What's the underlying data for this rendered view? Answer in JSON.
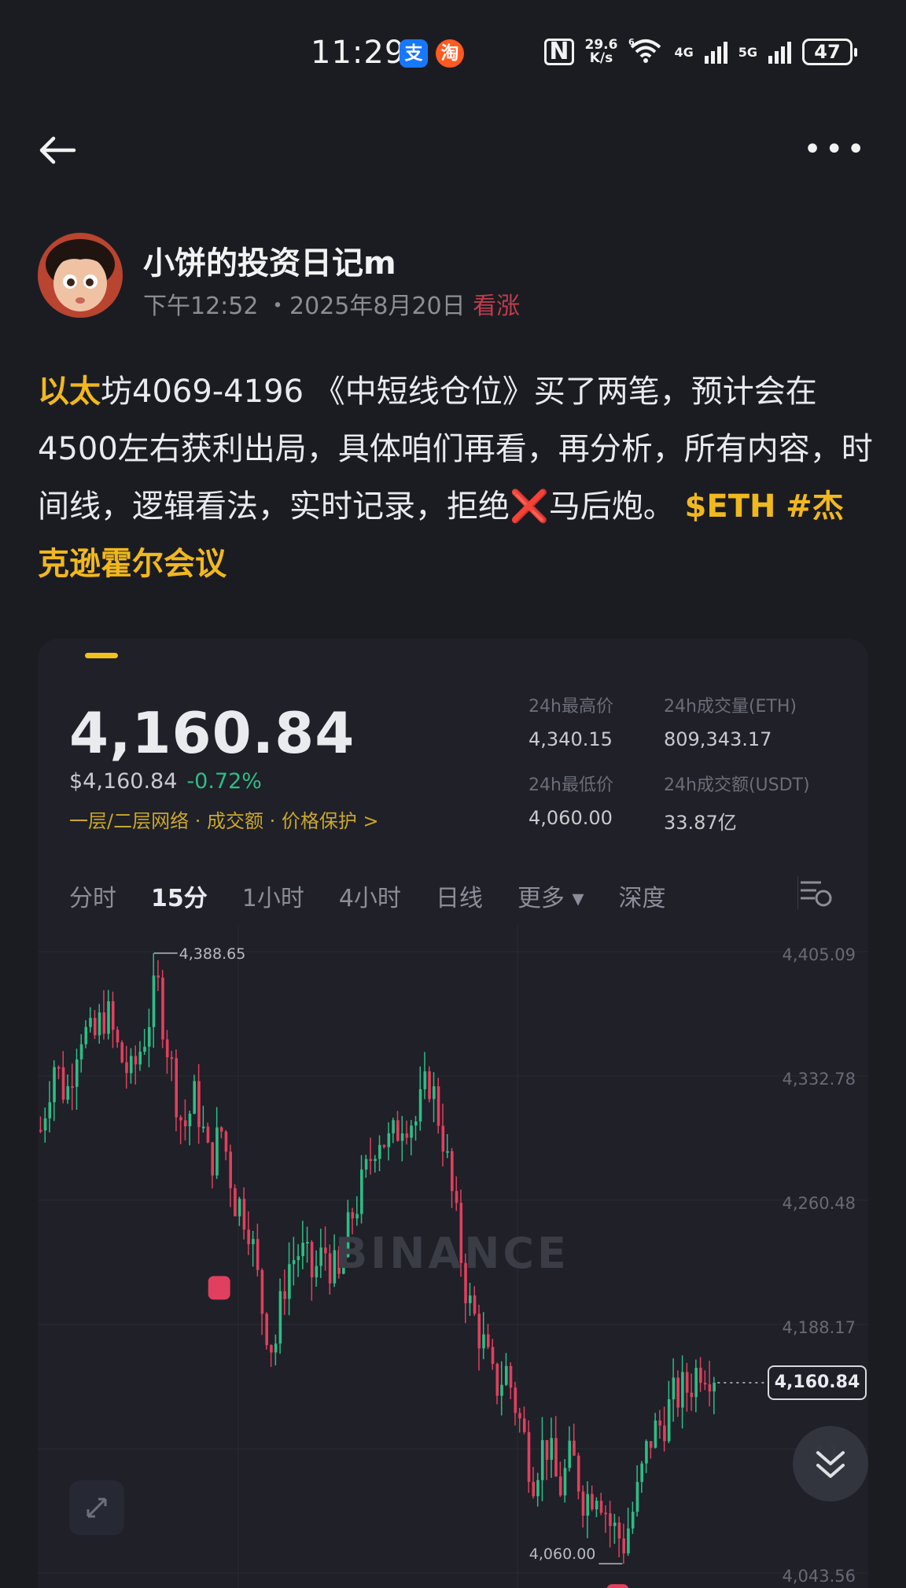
{
  "status_bar": {
    "time": "11:29",
    "app_icons": [
      "支",
      "淘"
    ],
    "net_speed_value": "29.6",
    "net_speed_unit": "K/s",
    "wifi_label": "6",
    "sig1_label": "4G",
    "sig2_label": "5G",
    "battery": "47"
  },
  "author": {
    "name": "小饼的投资日记m",
    "time": "下午12:52",
    "date": "・2025年8月20日",
    "sentiment": "看涨"
  },
  "post": {
    "lead_highlight": "以太",
    "text_part1": "坊4069-4196 《中短线仓位》买了两笔，预计会在4500左右获利出局，具体咱们再看，再分析，所有内容，时间线，逻辑看法，实时记录，拒绝",
    "cross_emoji": "❌",
    "text_part2": "马后炮。",
    "tag_symbol": "$ETH",
    "tag_topic": "#杰克逊霍尔会议"
  },
  "market": {
    "price": "4,160.84",
    "price_usd": "$4,160.84",
    "change": "-0.72%",
    "links": "一层/二层网络 · 成交额 · 价格保护 >",
    "high_label": "24h最高价",
    "high_value": "4,340.15",
    "low_label": "24h最低价",
    "low_value": "4,060.00",
    "vol_eth_label": "24h成交量(ETH)",
    "vol_eth_value": "809,343.17",
    "vol_usdt_label": "24h成交额(USDT)",
    "vol_usdt_value": "33.87亿",
    "intervals": [
      "分时",
      "15分",
      "1小时",
      "4小时",
      "日线",
      "更多 ▾",
      "深度"
    ],
    "active_interval": "15分"
  },
  "chart_data": {
    "type": "candlestick",
    "symbol": "ETH/USDT",
    "interval": "15分",
    "y_ticks": [
      "4,405.09",
      "4,332.78",
      "4,260.48",
      "4,188.17",
      "4,1…",
      "4,043.56"
    ],
    "ylim": [
      4043.56,
      4405.09
    ],
    "annotations": {
      "high": "4,388.65",
      "low": "4,060.00",
      "current": "4,160.84"
    },
    "watermark": "BINANCE",
    "close_path": [
      4300,
      4340,
      4320,
      4360,
      4350,
      4370,
      4345,
      4330,
      4355,
      4385,
      4340,
      4300,
      4320,
      4280,
      4300,
      4260,
      4250,
      4200,
      4170,
      4220,
      4230,
      4215,
      4230,
      4210,
      4250,
      4270,
      4300,
      4290,
      4310,
      4305,
      4330,
      4300,
      4250,
      4200,
      4180,
      4150,
      4160,
      4130,
      4100,
      4120,
      4090,
      4110,
      4085,
      4095,
      4070,
      4060,
      4085,
      4120,
      4130,
      4145,
      4150,
      4165,
      4160
    ]
  }
}
